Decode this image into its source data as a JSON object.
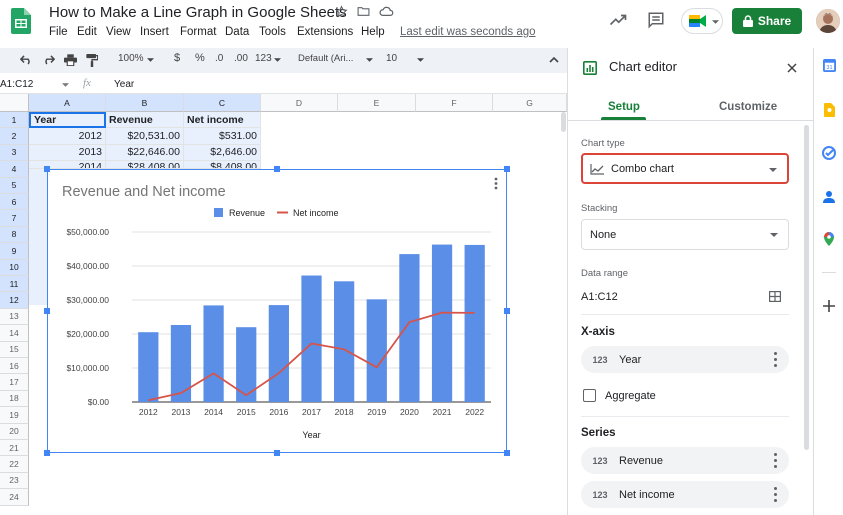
{
  "doc": {
    "title": "How to Make a Line Graph in Google Sheets",
    "last_edit": "Last edit was seconds ago"
  },
  "menu": [
    "File",
    "Edit",
    "View",
    "Insert",
    "Format",
    "Data",
    "Tools",
    "Extensions",
    "Help"
  ],
  "share_label": "Share",
  "toolbar": {
    "zoom": "100%",
    "currency": "$",
    "percent": "%",
    "dec_less": ".0",
    "dec_more": ".00",
    "more_formats": "123",
    "font": "Default (Ari...",
    "font_size": "10"
  },
  "formula_bar": {
    "name_box": "A1:C12",
    "fx": "fx",
    "value": "Year"
  },
  "grid": {
    "columns": [
      "A",
      "B",
      "C",
      "D",
      "E",
      "F",
      "G"
    ],
    "rows": [
      "1",
      "2",
      "3",
      "4",
      "5",
      "6",
      "7",
      "8",
      "9",
      "10",
      "11",
      "12",
      "13",
      "14",
      "15",
      "16",
      "17",
      "18",
      "19",
      "20",
      "21",
      "22",
      "23",
      "24"
    ],
    "headers": [
      "Year",
      "Revenue",
      "Net income"
    ],
    "data": [
      [
        "2012",
        "$20,531.00",
        "$531.00"
      ],
      [
        "2013",
        "$22,646.00",
        "$2,646.00"
      ],
      [
        "2014",
        "$28,408.00",
        "$8,408.00"
      ]
    ]
  },
  "chart_data": {
    "type": "bar",
    "title": "Revenue and Net income",
    "xlabel": "Year",
    "ylabel": "",
    "categories": [
      "2012",
      "2013",
      "2014",
      "2015",
      "2016",
      "2017",
      "2018",
      "2019",
      "2020",
      "2021",
      "2022"
    ],
    "series": [
      {
        "name": "Revenue",
        "type": "bar",
        "color": "#5b8ee6",
        "values": [
          20531,
          22646,
          28408,
          22000,
          28500,
          37200,
          35500,
          30200,
          43500,
          46300,
          46200
        ]
      },
      {
        "name": "Net income",
        "type": "line",
        "color": "#d6544a",
        "values": [
          531,
          2646,
          8408,
          2000,
          8500,
          17200,
          15500,
          10200,
          23500,
          26300,
          26200
        ]
      }
    ],
    "ylim": [
      0,
      50000
    ],
    "yticks": [
      "$0.00",
      "$10,000.00",
      "$20,000.00",
      "$30,000.00",
      "$40,000.00",
      "$50,000.00"
    ],
    "legend": "top-center",
    "grid": true
  },
  "editor": {
    "title": "Chart editor",
    "tabs": [
      "Setup",
      "Customize"
    ],
    "chart_type_label": "Chart type",
    "chart_type_value": "Combo chart",
    "stacking_label": "Stacking",
    "stacking_value": "None",
    "data_range_label": "Data range",
    "data_range_value": "A1:C12",
    "xaxis_label": "X-axis",
    "xaxis_value": "Year",
    "aggregate_label": "Aggregate",
    "series_label": "Series",
    "series": [
      "Revenue",
      "Net income"
    ],
    "num_glyph": "123"
  }
}
